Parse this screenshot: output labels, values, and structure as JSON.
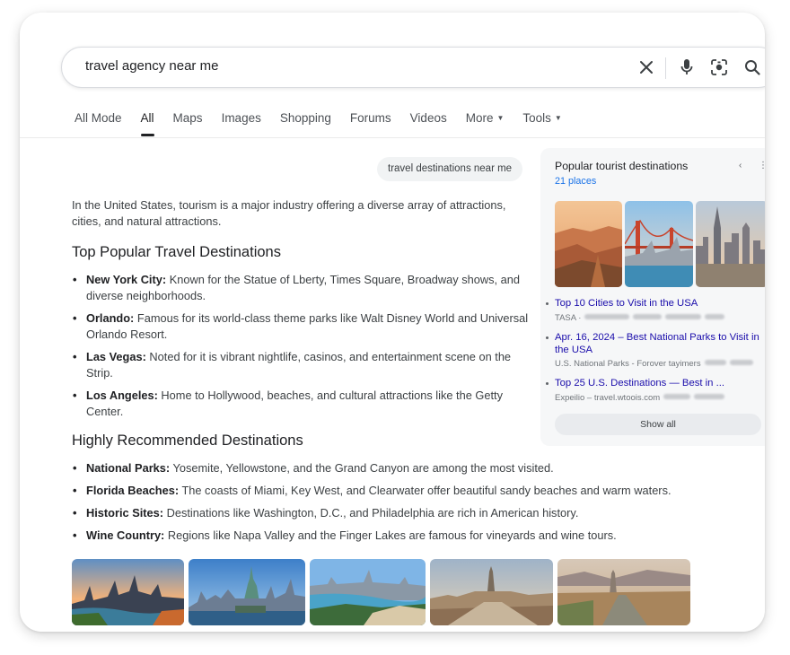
{
  "search": {
    "query": "travel agency near me"
  },
  "icons": {
    "clear": "close-icon",
    "voice": "microphone-icon",
    "lens": "camera-lens-icon",
    "search": "search-icon"
  },
  "tabs": [
    {
      "label": "All Mode"
    },
    {
      "label": "All",
      "active": true
    },
    {
      "label": "Maps"
    },
    {
      "label": "Images"
    },
    {
      "label": "Shopping"
    },
    {
      "label": "Forums"
    },
    {
      "label": "Videos"
    },
    {
      "label": "More",
      "dropdown": true
    },
    {
      "label": "Tools",
      "dropdown": true
    }
  ],
  "chip": "travel destinations near me",
  "main": {
    "intro": "In the United States, tourism is a major industry offering a diverse array of attractions, cities, and natural attractions.",
    "section1": {
      "heading": "Top Popular Travel Destinations",
      "items": [
        {
          "term": "New York City:",
          "text": " Known for the Statue of Lberty, Times Square, Broadway shows, and diverse neighborhoods."
        },
        {
          "term": "Orlando:",
          "text": " Famous for its world-class theme parks like Walt Disney World and Universal Orlando Resort."
        },
        {
          "term": "Las Vegas:",
          "text": " Noted for it is vibrant nightlife, casinos, and entertainment scene on the Strip."
        },
        {
          "term": "Los Angeles:",
          "text": " Home to Hollywood, beaches, and cultural attractions like the Getty Center."
        }
      ]
    },
    "section2": {
      "heading": "Highly Recommended Destinations",
      "items": [
        {
          "term": "National Parks:",
          "text": " Yosemite, Yellowstone, and the Grand Canyon are among the most visited."
        },
        {
          "term": "Florida Beaches:",
          "text": " The coasts of Miami, Key West, and Clearwater offer beautiful sandy beaches and warm waters."
        },
        {
          "term": "Historic Sites:",
          "text": " Destinations like Washington, D.C., and Philadelphia are rich in American history."
        },
        {
          "term": "Wine Country:",
          "text": " Regions like Napa Valley and the Finger Lakes are famous for vineyards and wine tours."
        }
      ]
    }
  },
  "panel": {
    "title": "Popular tourist destinations",
    "subtitle": "21 places",
    "results": [
      {
        "title": "Top 10 Cities to Visit in the USA",
        "source": "TASA ·"
      },
      {
        "title": "Apr. 16, 2024 – Best National Parks to Visit in the USA",
        "source": "U.S. National Parks - Forover tayimers"
      },
      {
        "title": "Top 25 U.S. Destinations — Best in ...",
        "source": "Expeilio – travel.wtoois.com"
      }
    ],
    "show_all": "Show all"
  },
  "colors": {
    "link": "#1a0dab",
    "accent": "#1a73e8",
    "text": "#202124",
    "panel_bg": "#f6f7f8"
  }
}
